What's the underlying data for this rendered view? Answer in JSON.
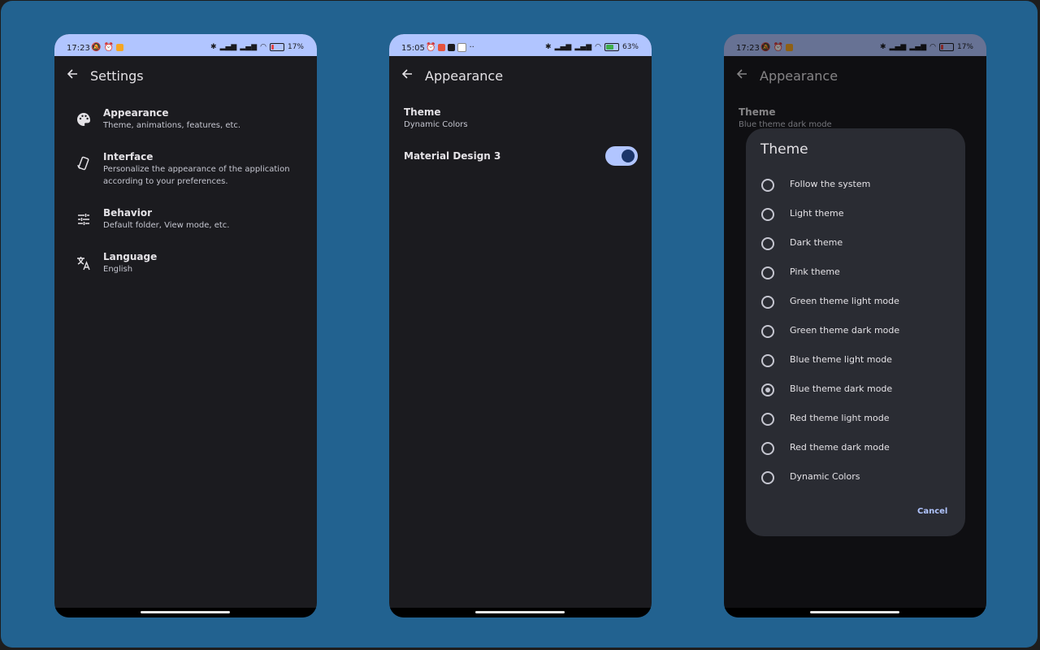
{
  "screens": [
    {
      "status": {
        "time": "17:23",
        "battery": "17",
        "battery_color": "#e54646"
      },
      "title": "Settings",
      "items": [
        {
          "title": "Appearance",
          "subtitle": "Theme, animations, features, etc.",
          "icon": "palette-icon"
        },
        {
          "title": "Interface",
          "subtitle": "Personalize the appearance of the application according to your preferences.",
          "icon": "interface-icon"
        },
        {
          "title": "Behavior",
          "subtitle": "Default folder, View mode, etc.",
          "icon": "tune-icon"
        },
        {
          "title": "Language",
          "subtitle": "English",
          "icon": "translate-icon"
        }
      ]
    },
    {
      "status": {
        "time": "15:05",
        "battery": "63",
        "battery_color": "#3fae49"
      },
      "title": "Appearance",
      "theme": {
        "title": "Theme",
        "subtitle": "Dynamic Colors"
      },
      "material": {
        "title": "Material Design 3",
        "enabled": true
      }
    },
    {
      "status": {
        "time": "17:23",
        "battery": "17",
        "battery_color": "#e54646"
      },
      "title": "Appearance",
      "theme": {
        "title": "Theme",
        "subtitle": "Blue theme dark mode"
      },
      "dialog": {
        "title": "Theme",
        "options": [
          {
            "label": "Follow the system",
            "selected": false
          },
          {
            "label": "Light theme",
            "selected": false
          },
          {
            "label": "Dark theme",
            "selected": false
          },
          {
            "label": "Pink theme",
            "selected": false
          },
          {
            "label": "Green theme light mode",
            "selected": false
          },
          {
            "label": "Green theme dark mode",
            "selected": false
          },
          {
            "label": "Blue theme light mode",
            "selected": false
          },
          {
            "label": "Blue theme dark mode",
            "selected": true
          },
          {
            "label": "Red theme light mode",
            "selected": false
          },
          {
            "label": "Red theme dark mode",
            "selected": false
          },
          {
            "label": "Dynamic Colors",
            "selected": false
          }
        ],
        "cancel_label": "Cancel"
      }
    }
  ],
  "colors": {
    "accent": "#b1c5ff",
    "background": "#1b1b1f",
    "frame": "#226290"
  }
}
